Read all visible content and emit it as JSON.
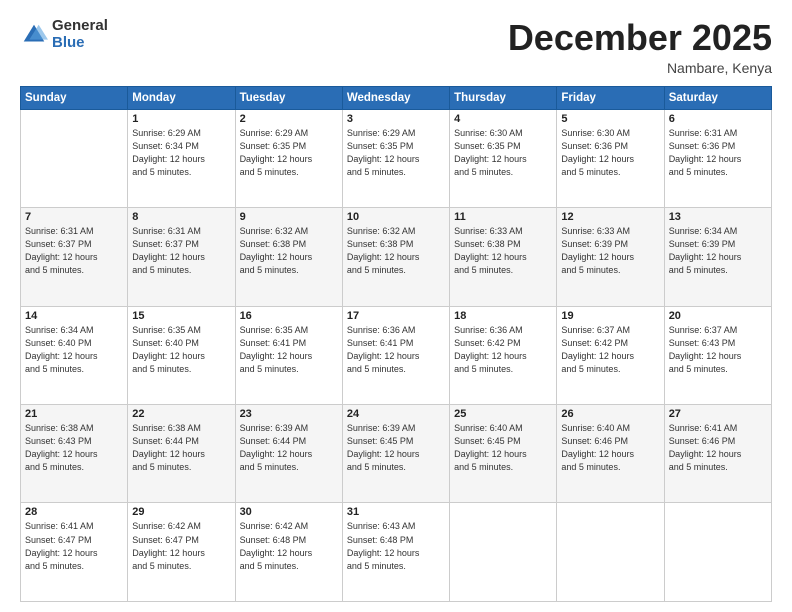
{
  "header": {
    "logo_general": "General",
    "logo_blue": "Blue",
    "month_title": "December 2025",
    "location": "Nambare, Kenya"
  },
  "days_of_week": [
    "Sunday",
    "Monday",
    "Tuesday",
    "Wednesday",
    "Thursday",
    "Friday",
    "Saturday"
  ],
  "weeks": [
    [
      {
        "day": "",
        "info": ""
      },
      {
        "day": "1",
        "info": "Sunrise: 6:29 AM\nSunset: 6:34 PM\nDaylight: 12 hours\nand 5 minutes."
      },
      {
        "day": "2",
        "info": "Sunrise: 6:29 AM\nSunset: 6:35 PM\nDaylight: 12 hours\nand 5 minutes."
      },
      {
        "day": "3",
        "info": "Sunrise: 6:29 AM\nSunset: 6:35 PM\nDaylight: 12 hours\nand 5 minutes."
      },
      {
        "day": "4",
        "info": "Sunrise: 6:30 AM\nSunset: 6:35 PM\nDaylight: 12 hours\nand 5 minutes."
      },
      {
        "day": "5",
        "info": "Sunrise: 6:30 AM\nSunset: 6:36 PM\nDaylight: 12 hours\nand 5 minutes."
      },
      {
        "day": "6",
        "info": "Sunrise: 6:31 AM\nSunset: 6:36 PM\nDaylight: 12 hours\nand 5 minutes."
      }
    ],
    [
      {
        "day": "7",
        "info": "Sunrise: 6:31 AM\nSunset: 6:37 PM\nDaylight: 12 hours\nand 5 minutes."
      },
      {
        "day": "8",
        "info": "Sunrise: 6:31 AM\nSunset: 6:37 PM\nDaylight: 12 hours\nand 5 minutes."
      },
      {
        "day": "9",
        "info": "Sunrise: 6:32 AM\nSunset: 6:38 PM\nDaylight: 12 hours\nand 5 minutes."
      },
      {
        "day": "10",
        "info": "Sunrise: 6:32 AM\nSunset: 6:38 PM\nDaylight: 12 hours\nand 5 minutes."
      },
      {
        "day": "11",
        "info": "Sunrise: 6:33 AM\nSunset: 6:38 PM\nDaylight: 12 hours\nand 5 minutes."
      },
      {
        "day": "12",
        "info": "Sunrise: 6:33 AM\nSunset: 6:39 PM\nDaylight: 12 hours\nand 5 minutes."
      },
      {
        "day": "13",
        "info": "Sunrise: 6:34 AM\nSunset: 6:39 PM\nDaylight: 12 hours\nand 5 minutes."
      }
    ],
    [
      {
        "day": "14",
        "info": "Sunrise: 6:34 AM\nSunset: 6:40 PM\nDaylight: 12 hours\nand 5 minutes."
      },
      {
        "day": "15",
        "info": "Sunrise: 6:35 AM\nSunset: 6:40 PM\nDaylight: 12 hours\nand 5 minutes."
      },
      {
        "day": "16",
        "info": "Sunrise: 6:35 AM\nSunset: 6:41 PM\nDaylight: 12 hours\nand 5 minutes."
      },
      {
        "day": "17",
        "info": "Sunrise: 6:36 AM\nSunset: 6:41 PM\nDaylight: 12 hours\nand 5 minutes."
      },
      {
        "day": "18",
        "info": "Sunrise: 6:36 AM\nSunset: 6:42 PM\nDaylight: 12 hours\nand 5 minutes."
      },
      {
        "day": "19",
        "info": "Sunrise: 6:37 AM\nSunset: 6:42 PM\nDaylight: 12 hours\nand 5 minutes."
      },
      {
        "day": "20",
        "info": "Sunrise: 6:37 AM\nSunset: 6:43 PM\nDaylight: 12 hours\nand 5 minutes."
      }
    ],
    [
      {
        "day": "21",
        "info": "Sunrise: 6:38 AM\nSunset: 6:43 PM\nDaylight: 12 hours\nand 5 minutes."
      },
      {
        "day": "22",
        "info": "Sunrise: 6:38 AM\nSunset: 6:44 PM\nDaylight: 12 hours\nand 5 minutes."
      },
      {
        "day": "23",
        "info": "Sunrise: 6:39 AM\nSunset: 6:44 PM\nDaylight: 12 hours\nand 5 minutes."
      },
      {
        "day": "24",
        "info": "Sunrise: 6:39 AM\nSunset: 6:45 PM\nDaylight: 12 hours\nand 5 minutes."
      },
      {
        "day": "25",
        "info": "Sunrise: 6:40 AM\nSunset: 6:45 PM\nDaylight: 12 hours\nand 5 minutes."
      },
      {
        "day": "26",
        "info": "Sunrise: 6:40 AM\nSunset: 6:46 PM\nDaylight: 12 hours\nand 5 minutes."
      },
      {
        "day": "27",
        "info": "Sunrise: 6:41 AM\nSunset: 6:46 PM\nDaylight: 12 hours\nand 5 minutes."
      }
    ],
    [
      {
        "day": "28",
        "info": "Sunrise: 6:41 AM\nSunset: 6:47 PM\nDaylight: 12 hours\nand 5 minutes."
      },
      {
        "day": "29",
        "info": "Sunrise: 6:42 AM\nSunset: 6:47 PM\nDaylight: 12 hours\nand 5 minutes."
      },
      {
        "day": "30",
        "info": "Sunrise: 6:42 AM\nSunset: 6:48 PM\nDaylight: 12 hours\nand 5 minutes."
      },
      {
        "day": "31",
        "info": "Sunrise: 6:43 AM\nSunset: 6:48 PM\nDaylight: 12 hours\nand 5 minutes."
      },
      {
        "day": "",
        "info": ""
      },
      {
        "day": "",
        "info": ""
      },
      {
        "day": "",
        "info": ""
      }
    ]
  ]
}
